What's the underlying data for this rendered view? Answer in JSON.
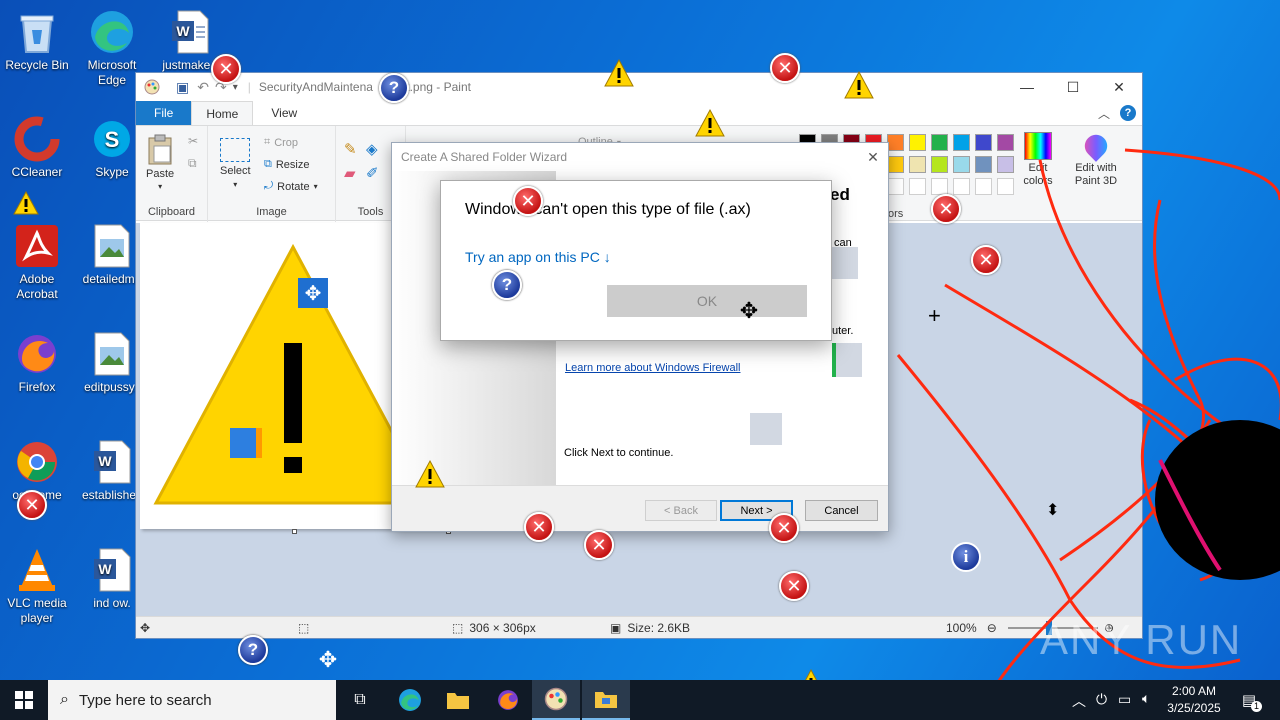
{
  "desktop": {
    "icons": [
      {
        "label": "Recycle Bin"
      },
      {
        "label": "Microsoft Edge"
      },
      {
        "label": "justmake.r"
      },
      {
        "label": "CCleaner"
      },
      {
        "label": "Skype"
      },
      {
        "label": "Adobe Acrobat"
      },
      {
        "label": "detailedma"
      },
      {
        "label": "Firefox"
      },
      {
        "label": "editpussy.j"
      },
      {
        "label": "ogle ome"
      },
      {
        "label": "establishec"
      },
      {
        "label": "VLC media player"
      },
      {
        "label": "ind     ow."
      }
    ]
  },
  "paint": {
    "title": "SecurityAndMaintena      lert.png - Paint",
    "tabs": {
      "file": "File",
      "home": "Home",
      "view": "View"
    },
    "ribbon": {
      "paste": "Paste",
      "clipboard": "Clipboard",
      "select": "Select",
      "crop": "Crop",
      "resize": "Resize",
      "rotate": "Rotate",
      "image": "Image",
      "tools": "Tools",
      "outline": "Outline",
      "colors_label": "ors",
      "edit_colors": "Edit colors",
      "edit_paint3d": "Edit with Paint 3D"
    },
    "colors": [
      "#000000",
      "#7f7f7f",
      "#880015",
      "#ed1c24",
      "#ff7f27",
      "#fff200",
      "#22b14c",
      "#00a2e8",
      "#3f48cc",
      "#a349a4",
      "#ffffff",
      "#c3c3c3",
      "#b97a57",
      "#ffaec9",
      "#ffc90e",
      "#efe4b0",
      "#b5e61d",
      "#99d9ea",
      "#7092be",
      "#c8bfe7"
    ],
    "status": {
      "dimensions": "306 × 306px",
      "size": "Size: 2.6KB",
      "zoom": "100%"
    }
  },
  "wizard": {
    "title": "Create A Shared Folder Wizard",
    "heading_fragment": "ed",
    "text_fragment_1": "can",
    "text_fragment_2": "uter.",
    "link": "Learn more about Windows Firewall",
    "continue": "Click Next to continue.",
    "back": "< Back",
    "next": "Next >",
    "cancel": "Cancel"
  },
  "openwith": {
    "message": "Windows can't open this type of file (.ax)",
    "try_app": "Try an app on this PC ↓",
    "ok": "OK"
  },
  "taskbar": {
    "search_placeholder": "Type here to search",
    "time": "2:00 AM",
    "date": "3/25/2025",
    "notification_count": "1"
  },
  "watermark": "ANY RUN"
}
